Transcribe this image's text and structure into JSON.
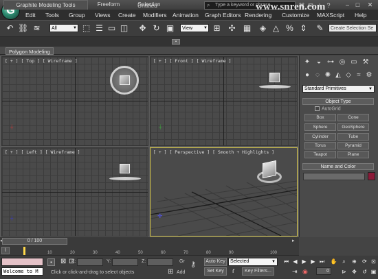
{
  "window": {
    "title": "Untitled",
    "app_logo": "G"
  },
  "quick_access": [
    "□",
    "⌂",
    "⤺",
    "⤻",
    "▤"
  ],
  "menu": [
    "Edit",
    "Tools",
    "Group",
    "Views",
    "Create",
    "Modifiers",
    "Animation",
    "Graph Editors",
    "Rendering",
    "Customize",
    "MAXScript",
    "Help"
  ],
  "search": {
    "placeholder": "Type a keyword or phrase"
  },
  "watermark": "www.snren.com",
  "toolbar": {
    "selection_filter": "All",
    "ref_coord": "View",
    "named_selection_placeholder": "Create Selection Se"
  },
  "ribbon": {
    "tabs": [
      "Graphite Modeling Tools",
      "Freeform",
      "Selection"
    ],
    "panel_label": "Polygon Modeling"
  },
  "viewports": {
    "top": "[ + ] [ Top ] [ Wireframe ]",
    "front": "[ + ] [ Front ] [ Wireframe ]",
    "left": "[ + ] [ Left ] [ Wireframe ]",
    "perspective": "[ + ] [ Perspective ] [ Smooth + Highlights ]"
  },
  "command_panel": {
    "dropdown": "Standard Primitives",
    "object_type_title": "Object Type",
    "autogrid": "AutoGrid",
    "buttons": [
      "Box",
      "Cone",
      "Sphere",
      "GeoSphere",
      "Cylinder",
      "Tube",
      "Torus",
      "Pyramid",
      "Teapot",
      "Plane"
    ],
    "name_color_title": "Name and Color",
    "object_color": "#8b1a38"
  },
  "timeline": {
    "slider": "0 / 100",
    "ticks": [
      "10",
      "20",
      "30",
      "40",
      "50",
      "60",
      "70",
      "80",
      "90",
      "100"
    ]
  },
  "status": {
    "maxscript": "Welcome to M",
    "message": "Click or click-and-drag to select objects",
    "x_label": "X:",
    "y_label": "Y:",
    "z_label": "Z:",
    "grid_label": "Gr",
    "add_time_tag": "Add",
    "auto_key": "Auto Key",
    "set_key": "Set Key",
    "key_filters": "Key Filters...",
    "selected_dropdown": "Selected",
    "frame": "0"
  }
}
